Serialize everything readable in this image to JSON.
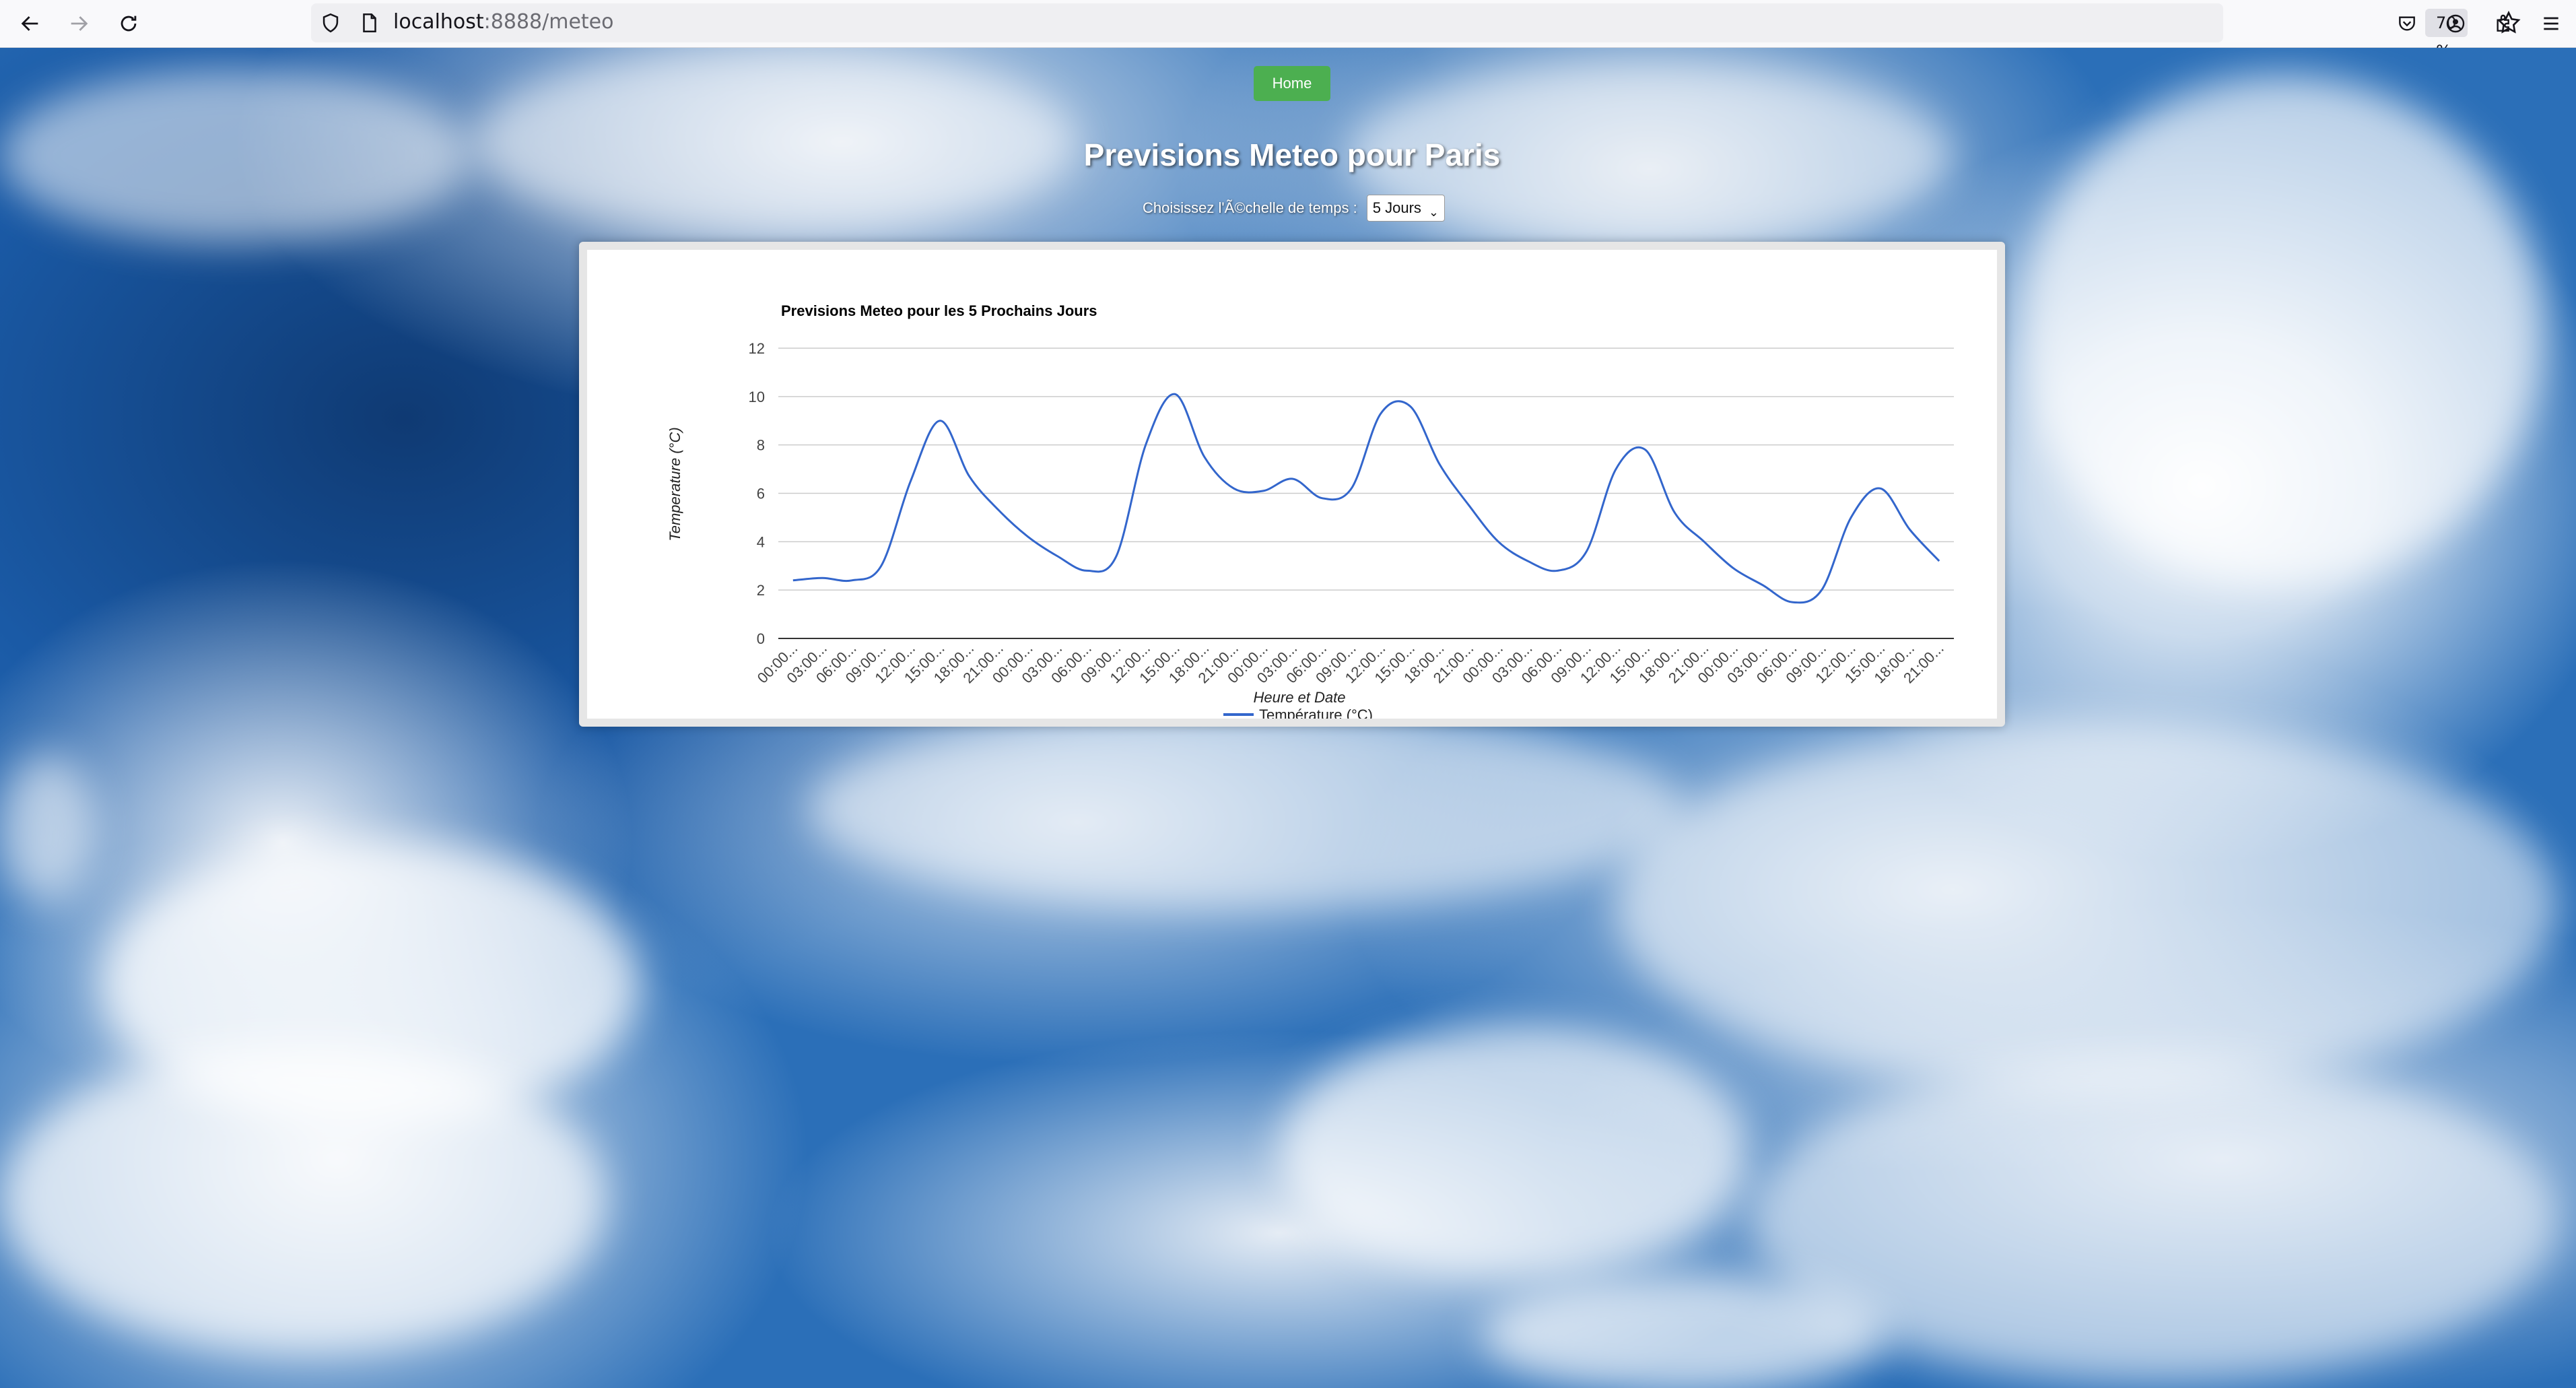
{
  "browser": {
    "url_host": "localhost",
    "url_rest": ":8888/meteo",
    "zoom": "70 %"
  },
  "page": {
    "home_label": "Home",
    "title": "Previsions Meteo pour Paris",
    "scale_label": "Choisissez l'Ã©chelle de temps :",
    "scale_selected": "5 Jours"
  },
  "colors": {
    "home_button": "#4caf50",
    "series_line": "#3366cc"
  },
  "chart_data": {
    "type": "line",
    "title": "Previsions Meteo pour les 5 Prochains Jours",
    "xlabel": "Heure et Date",
    "ylabel": "Temperature (°C)",
    "ylim": [
      0,
      12
    ],
    "yticks": [
      0,
      2,
      4,
      6,
      8,
      10,
      12
    ],
    "grid": true,
    "legend_position": "bottom",
    "categories": [
      "00:00...",
      "03:00...",
      "06:00...",
      "09:00...",
      "12:00...",
      "15:00...",
      "18:00...",
      "21:00...",
      "00:00...",
      "03:00...",
      "06:00...",
      "09:00...",
      "12:00...",
      "15:00...",
      "18:00...",
      "21:00...",
      "00:00...",
      "03:00...",
      "06:00...",
      "09:00...",
      "12:00...",
      "15:00...",
      "18:00...",
      "21:00...",
      "00:00...",
      "03:00...",
      "06:00...",
      "09:00...",
      "12:00...",
      "15:00...",
      "18:00...",
      "21:00...",
      "00:00...",
      "03:00...",
      "06:00...",
      "09:00...",
      "12:00...",
      "15:00...",
      "18:00...",
      "21:00..."
    ],
    "series": [
      {
        "name": "Température (°C)",
        "values": [
          2.4,
          2.5,
          2.4,
          3.0,
          6.5,
          9.0,
          6.7,
          5.3,
          4.2,
          3.4,
          2.8,
          3.4,
          8.0,
          10.1,
          7.5,
          6.2,
          6.1,
          6.6,
          5.8,
          6.2,
          9.3,
          9.6,
          7.2,
          5.5,
          4.0,
          3.2,
          2.8,
          3.6,
          7.0,
          7.8,
          5.2,
          4.0,
          2.9,
          2.2,
          1.5,
          2.0,
          5.0,
          6.2,
          4.5,
          3.2
        ]
      }
    ]
  }
}
